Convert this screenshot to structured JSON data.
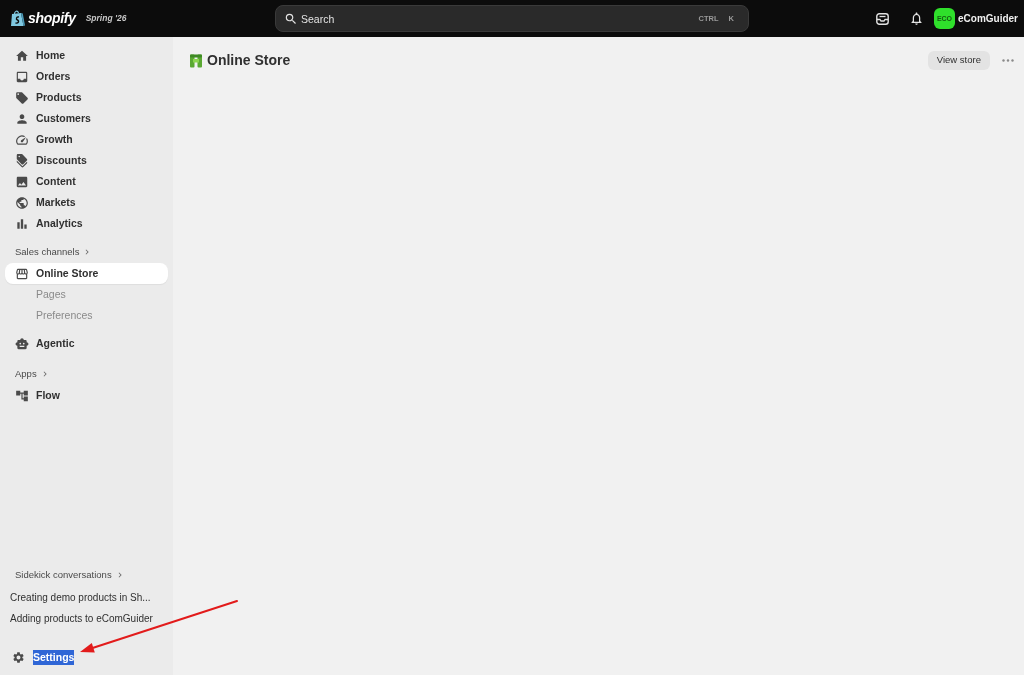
{
  "top_bar": {
    "logo": {
      "text": "shopify",
      "edition": "Spring '26"
    },
    "search": {
      "placeholder": "Search",
      "shortcut": [
        "CTRL",
        "K"
      ]
    },
    "account": {
      "initials": "ECO",
      "store_name": "eComGuider"
    }
  },
  "sidebar": {
    "items": [
      {
        "label": "Home",
        "selected": false
      },
      {
        "label": "Orders",
        "selected": false
      },
      {
        "label": "Products",
        "selected": false
      },
      {
        "label": "Customers",
        "selected": false
      },
      {
        "label": "Growth",
        "selected": false
      },
      {
        "label": "Discounts",
        "selected": false
      },
      {
        "label": "Content",
        "selected": false
      },
      {
        "label": "Markets",
        "selected": false
      },
      {
        "label": "Analytics",
        "selected": false
      }
    ],
    "sales_channels": {
      "heading": "Sales channels",
      "items": [
        {
          "label": "Online Store",
          "selected": true,
          "children": [
            {
              "label": "Pages",
              "selected": false
            },
            {
              "label": "Preferences",
              "selected": false
            }
          ]
        },
        {
          "label": "Agentic",
          "selected": false
        }
      ]
    },
    "apps": {
      "heading": "Apps",
      "items": [
        {
          "label": "Flow",
          "selected": false
        }
      ]
    },
    "sidekick": {
      "heading": "Sidekick conversations",
      "items": [
        {
          "label": "Creating demo products in Sh..."
        },
        {
          "label": "Adding products to eComGuider"
        }
      ]
    },
    "settings": {
      "label": "Settings",
      "highlighted": true
    }
  },
  "main": {
    "title": "Online Store",
    "actions": [
      {
        "label": "View store"
      }
    ]
  },
  "annotations": [
    {
      "kind": "arrow"
    }
  ]
}
